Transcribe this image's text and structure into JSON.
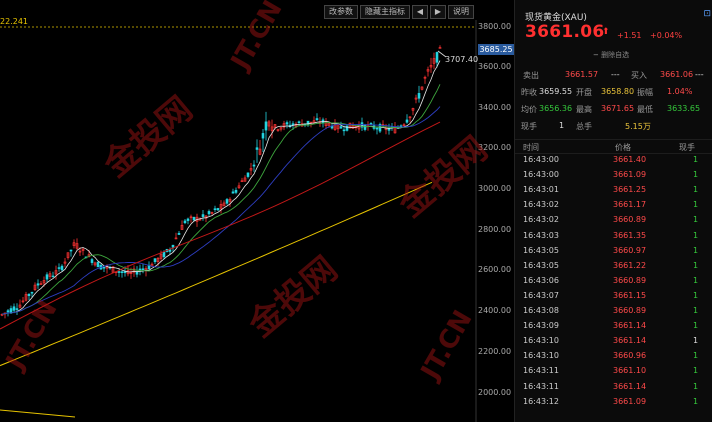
{
  "chart": {
    "toolbar": {
      "params_label": "改参数",
      "hide_indicator_label": "隐藏主指标",
      "prev_icon": "left-arrow-icon",
      "next_icon": "right-arrow-icon",
      "help_label": "说明"
    },
    "left_value": "22.241",
    "current_price_tag": "3685.25",
    "high_label": "3707.40",
    "yaxis": [
      "3800.00",
      "3600.00",
      "3400.00",
      "3200.00",
      "3000.00",
      "2800.00",
      "2600.00",
      "2400.00",
      "2200.00",
      "2000.00"
    ],
    "colors": {
      "up": "#ff3333",
      "down": "#22d4e0",
      "ma_short": "#e8e8e8",
      "ma_mid": "#3da53d",
      "ma_long1": "#c01818",
      "ma_long2": "#e6c300",
      "price_tag": "#2a5b9e"
    }
  },
  "quote": {
    "title": "现货黄金(XAU)",
    "add_icon": "add-watchlist-icon",
    "price": "3661.06",
    "arrow": "⬆",
    "change": "+1.51",
    "change_pct": "+0.04%",
    "delete_label": "删除自选",
    "sell_label": "卖出",
    "sell_price": "3661.57",
    "sell_vol": "---",
    "buy_label": "买入",
    "buy_price": "3661.06",
    "buy_vol": "---",
    "stats": [
      {
        "k1": "昨收",
        "v1": "3659.55",
        "k2": "开盘",
        "v2": "3658.80",
        "k3": "振幅",
        "v3": "1.04%"
      },
      {
        "k1": "均价",
        "v1": "3656.36",
        "k2": "最高",
        "v2": "3671.65",
        "k3": "最低",
        "v3": "3633.65"
      },
      {
        "k1": "现手",
        "v1": "1",
        "k2": "总手",
        "v2": "5.15万",
        "k3": "",
        "v3": ""
      }
    ]
  },
  "ticks": {
    "headers": {
      "time": "时间",
      "price": "价格",
      "volume": "现手"
    },
    "rows": [
      {
        "time": "16:43:00",
        "price": "3661.40",
        "vol": "1",
        "pc": "red",
        "vc": "green"
      },
      {
        "time": "16:43:00",
        "price": "3661.09",
        "vol": "1",
        "pc": "red",
        "vc": "green"
      },
      {
        "time": "16:43:01",
        "price": "3661.25",
        "vol": "1",
        "pc": "red",
        "vc": "green"
      },
      {
        "time": "16:43:02",
        "price": "3661.17",
        "vol": "1",
        "pc": "red",
        "vc": "green"
      },
      {
        "time": "16:43:02",
        "price": "3660.89",
        "vol": "1",
        "pc": "red",
        "vc": "green"
      },
      {
        "time": "16:43:03",
        "price": "3661.35",
        "vol": "1",
        "pc": "red",
        "vc": "green"
      },
      {
        "time": "16:43:05",
        "price": "3660.97",
        "vol": "1",
        "pc": "red",
        "vc": "green"
      },
      {
        "time": "16:43:05",
        "price": "3661.22",
        "vol": "1",
        "pc": "red",
        "vc": "green"
      },
      {
        "time": "16:43:06",
        "price": "3660.89",
        "vol": "1",
        "pc": "red",
        "vc": "green"
      },
      {
        "time": "16:43:07",
        "price": "3661.15",
        "vol": "1",
        "pc": "red",
        "vc": "green"
      },
      {
        "time": "16:43:08",
        "price": "3660.89",
        "vol": "1",
        "pc": "red",
        "vc": "green"
      },
      {
        "time": "16:43:09",
        "price": "3661.14",
        "vol": "1",
        "pc": "red",
        "vc": "green"
      },
      {
        "time": "16:43:10",
        "price": "3661.14",
        "vol": "1",
        "pc": "red",
        "vc": "white"
      },
      {
        "time": "16:43:10",
        "price": "3660.96",
        "vol": "1",
        "pc": "red",
        "vc": "green"
      },
      {
        "time": "16:43:11",
        "price": "3661.10",
        "vol": "1",
        "pc": "red",
        "vc": "green"
      },
      {
        "time": "16:43:11",
        "price": "3661.14",
        "vol": "1",
        "pc": "red",
        "vc": "green"
      },
      {
        "time": "16:43:12",
        "price": "3661.09",
        "vol": "1",
        "pc": "red",
        "vc": "green"
      }
    ]
  },
  "watermark": {
    "brand": "金投网",
    "domain": "JT.CN"
  }
}
